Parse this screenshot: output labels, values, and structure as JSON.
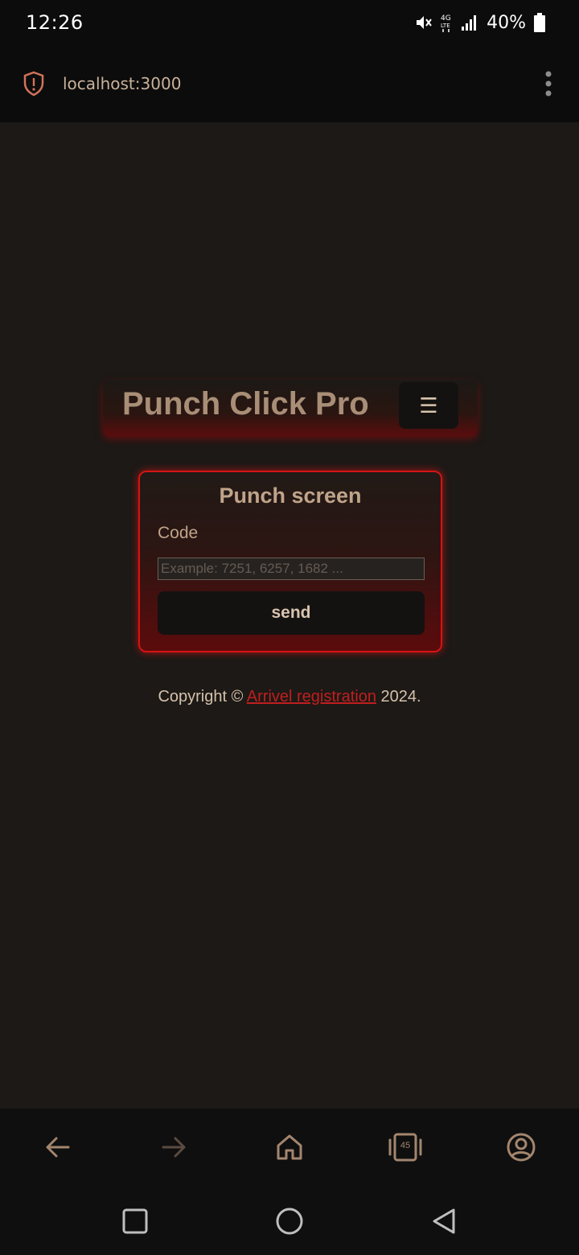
{
  "status_bar": {
    "time": "12:26",
    "battery": "40%"
  },
  "url_bar": {
    "url": "localhost:3000"
  },
  "header": {
    "brand": "Punch Click Pro",
    "menu_icon": "☰"
  },
  "punch_card": {
    "title": "Punch screen",
    "code_label": "Code",
    "code_placeholder": "Example: 7251, 6257, 1682 ...",
    "code_value": "",
    "send_label": "send"
  },
  "footer": {
    "prefix": "Copyright © ",
    "link_text": "Arrivel registration",
    "suffix": " 2024."
  },
  "browser_toolbar": {
    "tab_count": "45"
  },
  "colors": {
    "accent_red": "#d41414",
    "text_tan": "#bda58c",
    "background": "#1c1916"
  }
}
